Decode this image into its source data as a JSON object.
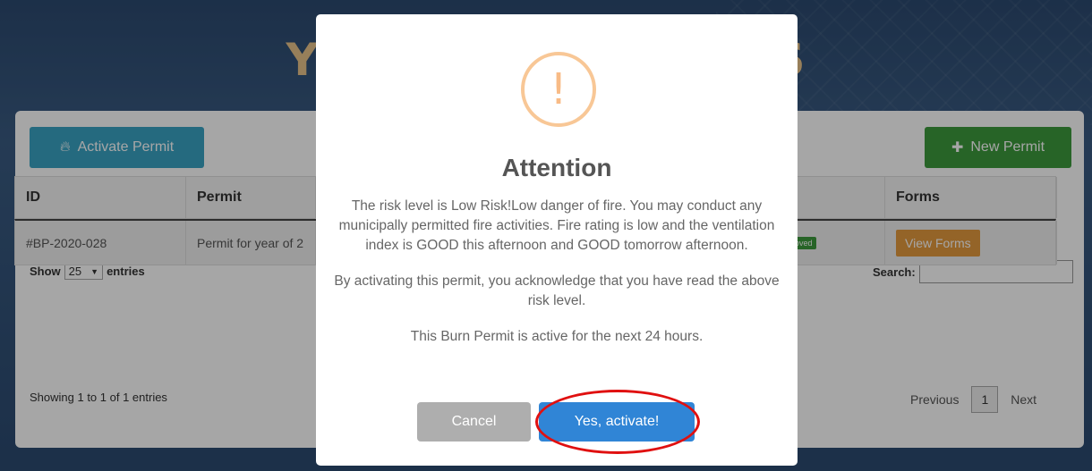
{
  "page": {
    "title": "YOUR FIRE PERMITS"
  },
  "toolbar": {
    "activate_label": "Activate Permit",
    "new_label": "New Permit"
  },
  "table": {
    "show_label": "Show",
    "entries_value": "25",
    "entries_label": "entries",
    "search_label": "Search:",
    "search_value": "",
    "headers": [
      "ID",
      "Permit",
      "Forms"
    ],
    "rows": [
      {
        "id": "#BP-2020-028",
        "permit": "Permit for year of 2",
        "status": "oved",
        "forms": "View Forms"
      }
    ],
    "showing": "Showing 1 to 1 of 1 entries",
    "pager": {
      "prev": "Previous",
      "page": "1",
      "next": "Next"
    }
  },
  "modal": {
    "title": "Attention",
    "icon": "!",
    "risk_text": "The risk level is Low Risk!Low danger of fire. You may conduct any municipally permitted fire activities. Fire rating is low and the ventilation index is GOOD this afternoon and GOOD tomorrow afternoon.",
    "ack_text": "By activating this permit, you acknowledge that you have read the above risk level.",
    "active_text": "This Burn Permit is active for the next 24 hours.",
    "cancel_label": "Cancel",
    "confirm_label": "Yes, activate!"
  },
  "colors": {
    "banner": "#2c4a70",
    "title": "#e8c38a",
    "activate": "#3aa4c4",
    "new": "#3d9a3d",
    "confirm": "#3085d6",
    "warning": "#f8bb86",
    "highlight": "#e01010"
  }
}
